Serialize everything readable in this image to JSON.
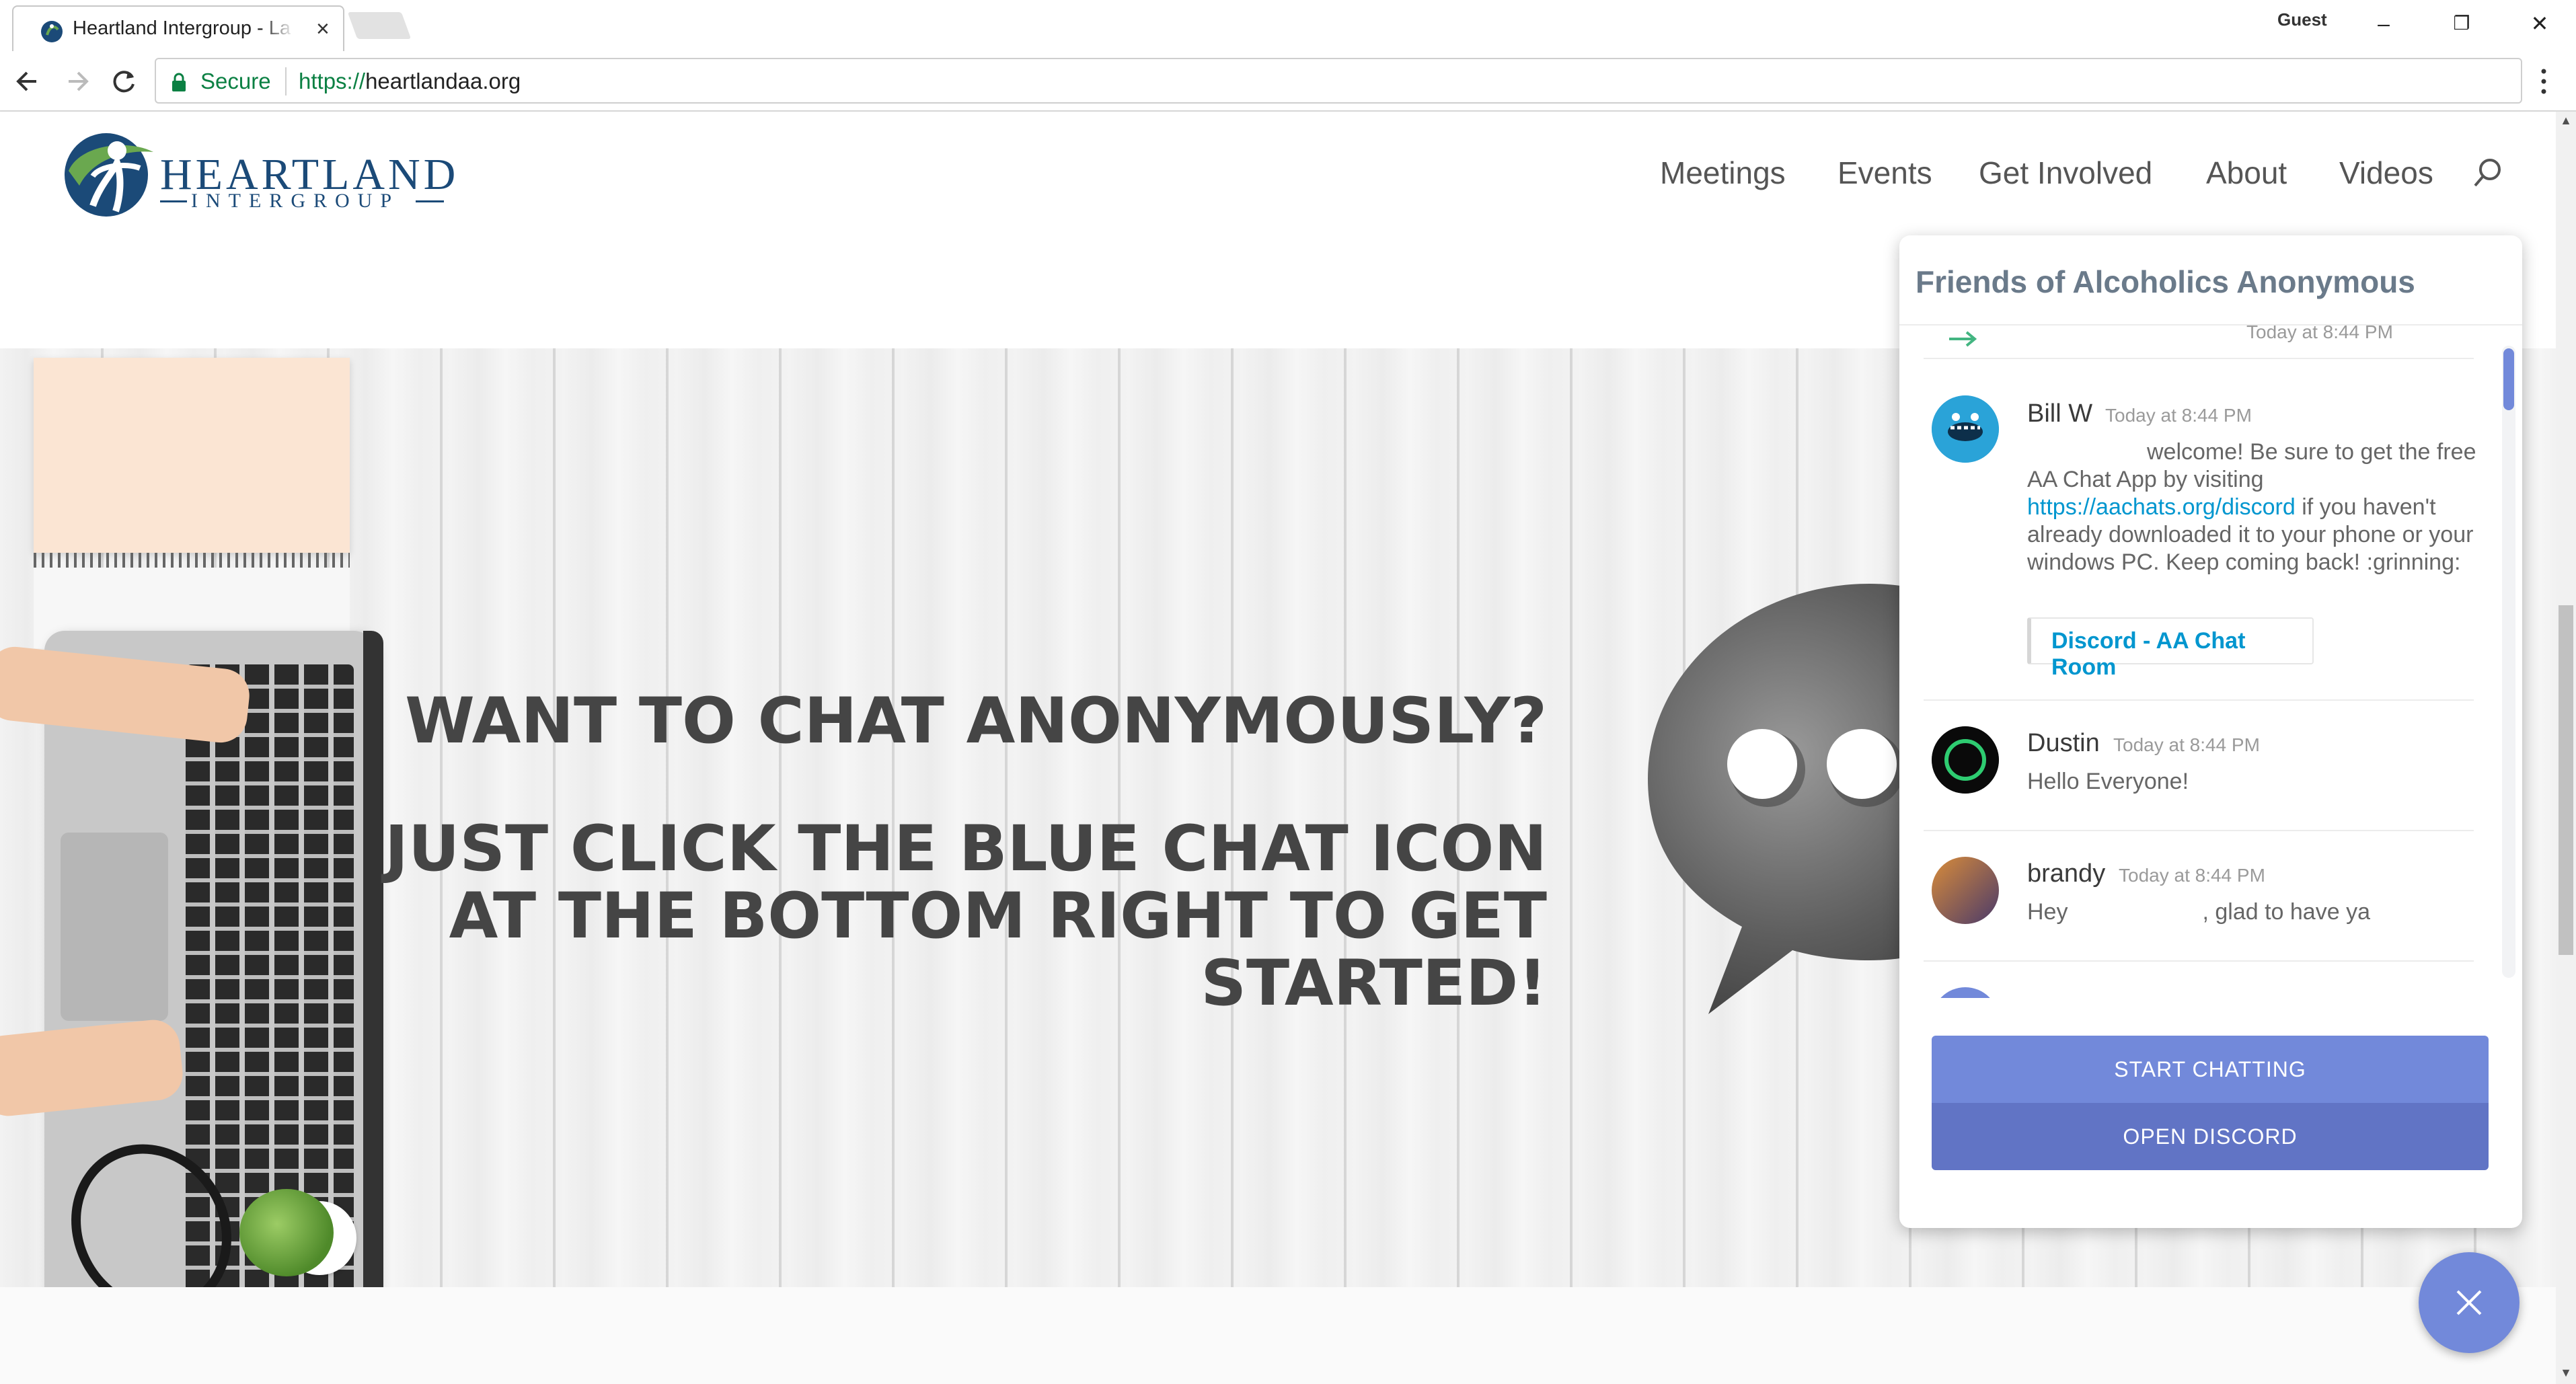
{
  "browser": {
    "tab_title": "Heartland Intergroup - La",
    "tab_close": "×",
    "profile": "Guest",
    "window_controls": {
      "minimize": "–",
      "restore": "❐",
      "close": "✕"
    },
    "secure_label": "Secure",
    "url_scheme": "https://",
    "url_host": "heartlandaa.org"
  },
  "site": {
    "logo_heartland": "HEARTLAND",
    "logo_intergroup": "INTERGROUP",
    "nav": [
      "Meetings",
      "Events",
      "Get Involved",
      "About",
      "Videos"
    ]
  },
  "hero": {
    "line1": "WANT TO CHAT ANONYMOUSLY?",
    "line2": "JUST CLICK THE BLUE CHAT ICON",
    "line3": "AT THE BOTTOM RIGHT TO GET",
    "line4": "STARTED!"
  },
  "widget": {
    "title": "Friends of Alcoholics Anonymous",
    "partial_timestamp": "Today at 8:44 PM",
    "messages": [
      {
        "user": "Bill W",
        "time": "Today at 8:44 PM",
        "text_before": "welcome! Be sure to get the free AA Chat App by visiting",
        "link": "https://aachats.org/discord",
        "text_after": "if you haven't already downloaded it to your phone or your windows PC. Keep coming back! :grinning:",
        "embed": "Discord - AA Chat Room"
      },
      {
        "user": "Dustin",
        "time": "Today at 8:44 PM",
        "text": "Hello Everyone!"
      },
      {
        "user": "brandy",
        "time": "Today at 8:44 PM",
        "text_before": "Hey",
        "text_after": ", glad to have ya"
      }
    ],
    "start_button": "START CHATTING",
    "open_button": "OPEN DISCORD"
  },
  "colors": {
    "discord_blurple": "#7289da",
    "secure_green": "#0b8043",
    "link_blue": "#0096cf",
    "logo_navy": "#1b4a78",
    "logo_green": "#6aa84f"
  },
  "icons": [
    "back-arrow-icon",
    "forward-arrow-icon",
    "reload-icon",
    "lock-icon",
    "menu-icon",
    "search-icon",
    "chat-bubble-icon",
    "close-icon"
  ]
}
